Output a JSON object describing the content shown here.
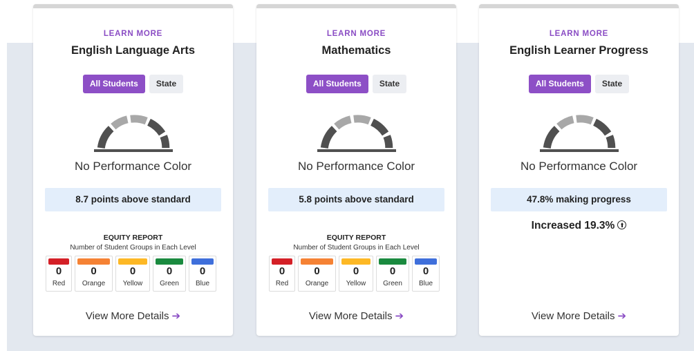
{
  "colors": {
    "accent": "#8d4fc6",
    "status_box": "#e3eefb",
    "gauge_dark": "#505050",
    "gauge_light": "#a8a8a8",
    "red": "#d42027",
    "orange": "#f58234",
    "yellow": "#fdb825",
    "green": "#1a8a3f",
    "blue": "#3f6fdb"
  },
  "cards": [
    {
      "learn_more": "LEARN MORE",
      "title": "English Language Arts",
      "toggle": {
        "all_students": "All Students",
        "state": "State"
      },
      "performance_color": "No Performance Color",
      "status": "8.7 points above standard",
      "equity": {
        "title": "EQUITY REPORT",
        "subtitle": "Number of Student Groups in Each Level",
        "levels": [
          {
            "count": "0",
            "name": "Red"
          },
          {
            "count": "0",
            "name": "Orange"
          },
          {
            "count": "0",
            "name": "Yellow"
          },
          {
            "count": "0",
            "name": "Green"
          },
          {
            "count": "0",
            "name": "Blue"
          }
        ]
      },
      "details": "View More Details"
    },
    {
      "learn_more": "LEARN MORE",
      "title": "Mathematics",
      "toggle": {
        "all_students": "All Students",
        "state": "State"
      },
      "performance_color": "No Performance Color",
      "status": "5.8 points above standard",
      "equity": {
        "title": "EQUITY REPORT",
        "subtitle": "Number of Student Groups in Each Level",
        "levels": [
          {
            "count": "0",
            "name": "Red"
          },
          {
            "count": "0",
            "name": "Orange"
          },
          {
            "count": "0",
            "name": "Yellow"
          },
          {
            "count": "0",
            "name": "Green"
          },
          {
            "count": "0",
            "name": "Blue"
          }
        ]
      },
      "details": "View More Details"
    },
    {
      "learn_more": "LEARN MORE",
      "title": "English Learner Progress",
      "toggle": {
        "all_students": "All Students",
        "state": "State"
      },
      "performance_color": "No Performance Color",
      "status": "47.8% making progress",
      "change": "Increased 19.3%",
      "change_icon": "arrow-up-circle-icon",
      "details": "View More Details"
    }
  ]
}
